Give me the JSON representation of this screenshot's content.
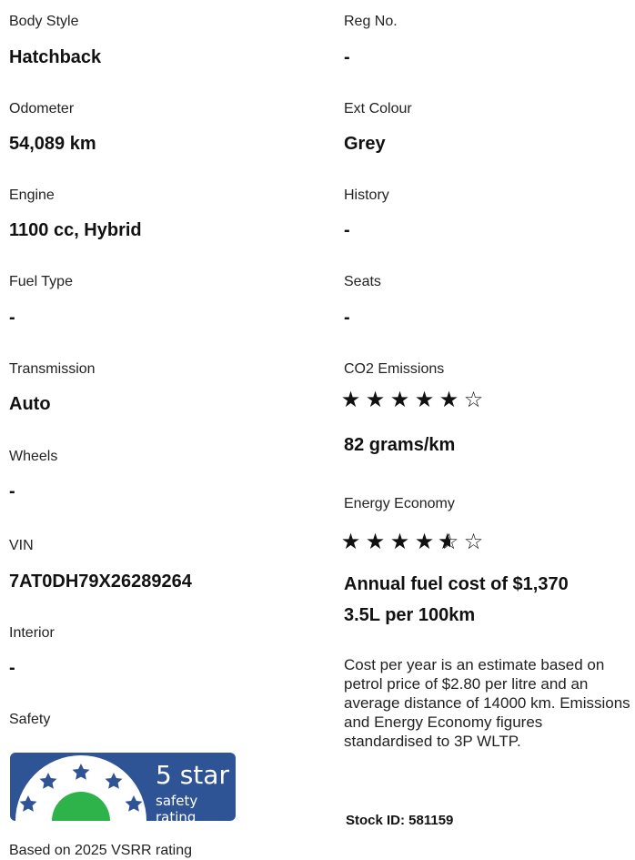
{
  "left": [
    {
      "label": "Body Style",
      "value": "Hatchback"
    },
    {
      "label": "Odometer",
      "value": "54,089 km"
    },
    {
      "label": "Engine",
      "value": "1100 cc, Hybrid"
    },
    {
      "label": "Fuel Type",
      "value": "-"
    },
    {
      "label": "Transmission",
      "value": "Auto"
    },
    {
      "label": "Wheels",
      "value": "-"
    },
    {
      "label": "VIN",
      "value": "7AT0DH79X26289264"
    },
    {
      "label": "Interior",
      "value": "-"
    }
  ],
  "right": [
    {
      "label": "Reg No.",
      "value": "-"
    },
    {
      "label": "Ext Colour",
      "value": "Grey"
    },
    {
      "label": "History",
      "value": "-"
    },
    {
      "label": "Seats",
      "value": "-"
    }
  ],
  "co2": {
    "label": "CO2 Emissions",
    "rating": 5,
    "max": 6,
    "value": "82 grams/km"
  },
  "energy": {
    "label": "Energy Economy",
    "rating": 4.5,
    "max": 6,
    "annual_cost": "Annual fuel cost of $1,370",
    "consumption": "3.5L per 100km"
  },
  "note": "Cost per year is an estimate based on petrol price of  $2.80 per litre and an average distance of 14000 km. Emissions and Energy Economy figures standardised to 3P WLTP.",
  "stock_id": "Stock ID: 581159",
  "safety": {
    "label": "Safety",
    "badge_line1": "5 star",
    "badge_line2": "safety rating",
    "footnote": "Based on 2025 VSRR rating",
    "colors": {
      "badge_bg": "#2f5496",
      "badge_green": "#2eb34a"
    }
  }
}
